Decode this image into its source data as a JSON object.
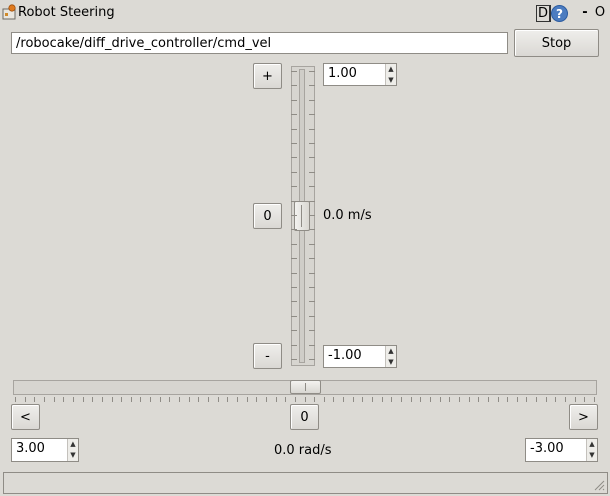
{
  "window": {
    "title": "Robot Steering",
    "dock_label": "D",
    "help_label": "?",
    "minimize_label": "-",
    "close_label": "O"
  },
  "topic": {
    "value": "/robocake/diff_drive_controller/cmd_vel",
    "placeholder": ""
  },
  "stop_label": "Stop",
  "linear": {
    "plus_label": "+",
    "zero_label": "0",
    "minus_label": "-",
    "max_value": "1.00",
    "min_value": "-1.00",
    "current_label": "0.0 m/s",
    "current": 0.0,
    "range": [
      -1.0,
      1.0
    ]
  },
  "angular": {
    "left_label": "<",
    "zero_label": "0",
    "right_label": ">",
    "left_value": "3.00",
    "right_value": "-3.00",
    "current_label": "0.0 rad/s",
    "current": 0.0,
    "range": [
      -3.0,
      3.0
    ]
  },
  "icons": {
    "app": "robot-steering-app-icon",
    "spin_up": "▲",
    "spin_down": "▼"
  },
  "status_text": ""
}
